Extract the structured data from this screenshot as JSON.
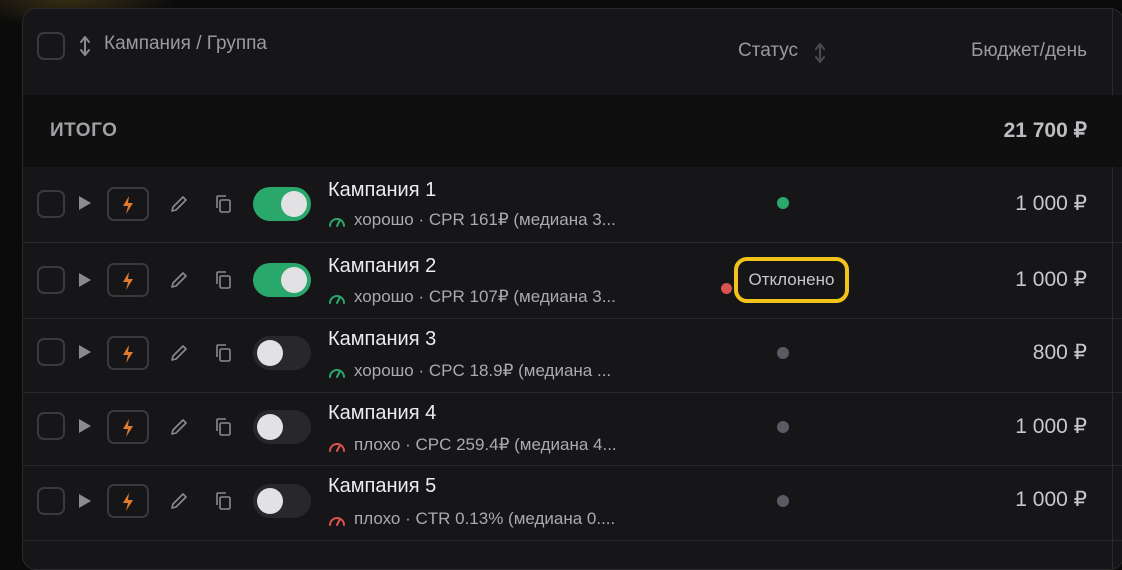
{
  "header": {
    "campaign_group": "Кампания / Группа",
    "status": "Статус",
    "budget": "Бюджет/день"
  },
  "total": {
    "label": "ИТОГО",
    "value": "21 700 ₽"
  },
  "rows": [
    {
      "name": "Кампания 1",
      "metric": "хорошо · CPR 161₽ (медиана 3...",
      "quality": "good",
      "enabled": true,
      "status_text": "",
      "status_color": "#2aa86c",
      "budget": "1 000 ₽"
    },
    {
      "name": "Кампания 2",
      "metric": "хорошо · CPR 107₽ (медиана 3...",
      "quality": "good",
      "enabled": true,
      "status_text": "Отклонено",
      "status_color": "#d9534f",
      "budget": "1 000 ₽"
    },
    {
      "name": "Кампания 3",
      "metric": "хорошо · CPC 18.9₽ (медиана ...",
      "quality": "good",
      "enabled": false,
      "status_text": "",
      "status_color": "#5a5a62",
      "budget": "800 ₽"
    },
    {
      "name": "Кампания 4",
      "metric": "плохо · CPC 259.4₽ (медиана 4...",
      "quality": "bad",
      "enabled": false,
      "status_text": "",
      "status_color": "#5a5a62",
      "budget": "1 000 ₽"
    },
    {
      "name": "Кампания 5",
      "metric": "плохо · CTR 0.13% (медиана 0....",
      "quality": "bad",
      "enabled": false,
      "status_text": "",
      "status_color": "#5a5a62",
      "budget": "1 000 ₽"
    }
  ],
  "colors": {
    "accent_good": "#2aa86c",
    "accent_bad": "#d9534f",
    "highlight": "#f2c318",
    "bolt": "#e07a2e"
  }
}
